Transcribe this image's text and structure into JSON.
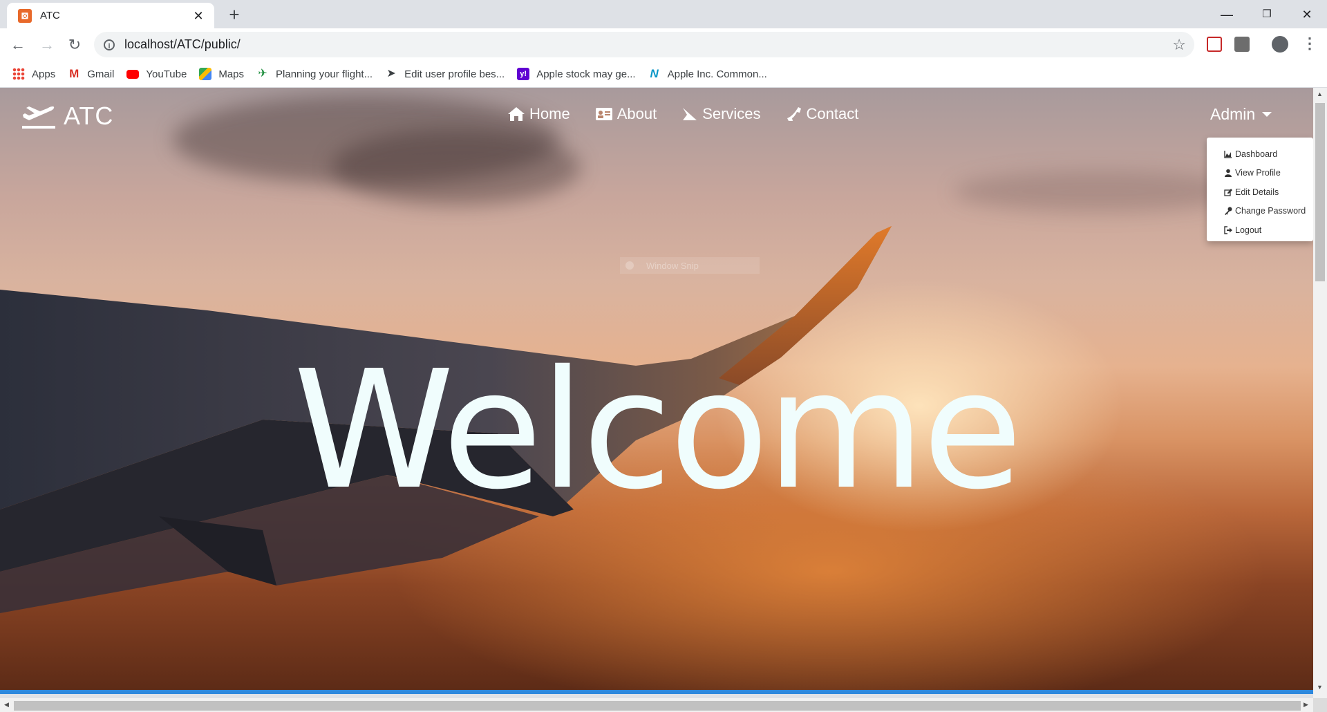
{
  "browser": {
    "tab_title": "ATC",
    "url": "localhost/ATC/public/",
    "bookmarks": [
      {
        "label": "Apps",
        "icon": "apps-grid-icon"
      },
      {
        "label": "Gmail",
        "icon": "gmail-icon"
      },
      {
        "label": "YouTube",
        "icon": "youtube-icon"
      },
      {
        "label": "Maps",
        "icon": "maps-icon"
      },
      {
        "label": "Planning your flight...",
        "icon": "flight-icon"
      },
      {
        "label": "Edit user profile bes...",
        "icon": "send-icon"
      },
      {
        "label": "Apple stock may ge...",
        "icon": "yahoo-icon"
      },
      {
        "label": "Apple Inc. Common...",
        "icon": "nasdaq-icon"
      }
    ]
  },
  "site": {
    "brand": "ATC",
    "nav": {
      "home": "Home",
      "about": "About",
      "services": "Services",
      "contact": "Contact"
    },
    "user_menu": {
      "label": "Admin",
      "items": {
        "dashboard": "Dashboard",
        "view_profile": "View Profile",
        "edit_details": "Edit Details",
        "change_password": "Change Password",
        "logout": "Logout"
      }
    },
    "hero_text": "Welcome",
    "snip_overlay": "Window Snip"
  }
}
